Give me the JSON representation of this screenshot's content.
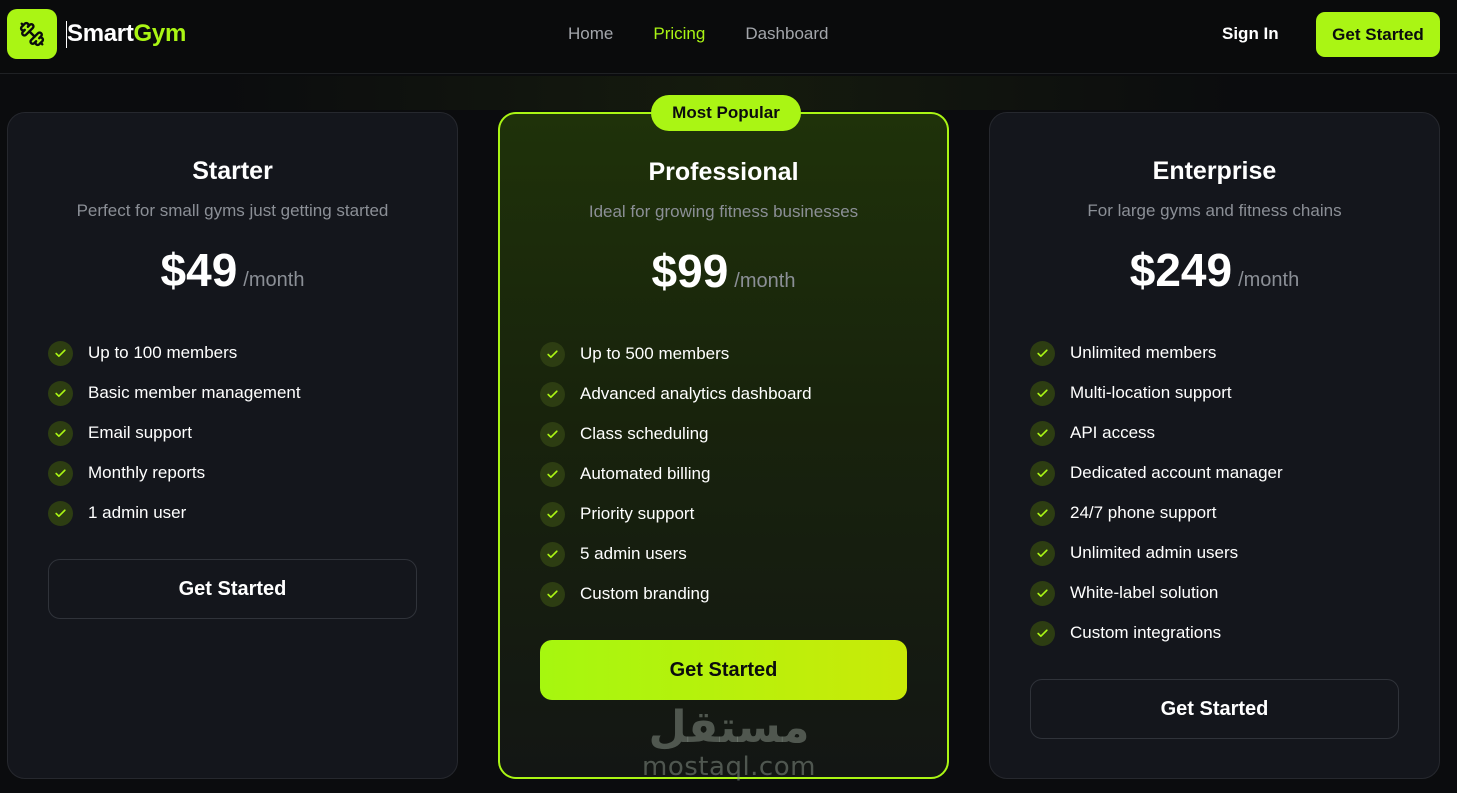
{
  "brand": {
    "part1": "Smart",
    "part2": "Gym",
    "accent": "#aaf514",
    "icon": "dumbbell-icon"
  },
  "nav": {
    "links": [
      {
        "label": "Home",
        "active": false
      },
      {
        "label": "Pricing",
        "active": true
      },
      {
        "label": "Dashboard",
        "active": false
      }
    ],
    "sign_in": "Sign In",
    "cta": "Get Started"
  },
  "plans": [
    {
      "name": "Starter",
      "description": "Perfect for small gyms just getting started",
      "price": "$49",
      "period": "/month",
      "features": [
        "Up to 100 members",
        "Basic member management",
        "Email support",
        "Monthly reports",
        "1 admin user"
      ],
      "cta": "Get Started"
    },
    {
      "name": "Professional",
      "badge": "Most Popular",
      "description": "Ideal for growing fitness businesses",
      "price": "$99",
      "period": "/month",
      "features": [
        "Up to 500 members",
        "Advanced analytics dashboard",
        "Class scheduling",
        "Automated billing",
        "Priority support",
        "5 admin users",
        "Custom branding"
      ],
      "cta": "Get Started"
    },
    {
      "name": "Enterprise",
      "description": "For large gyms and fitness chains",
      "price": "$249",
      "period": "/month",
      "features": [
        "Unlimited members",
        "Multi-location support",
        "API access",
        "Dedicated account manager",
        "24/7 phone support",
        "Unlimited admin users",
        "White-label solution",
        "Custom integrations"
      ],
      "cta": "Get Started"
    }
  ],
  "watermark": {
    "arabic": "مستقل",
    "latin": "mostaql.com"
  }
}
